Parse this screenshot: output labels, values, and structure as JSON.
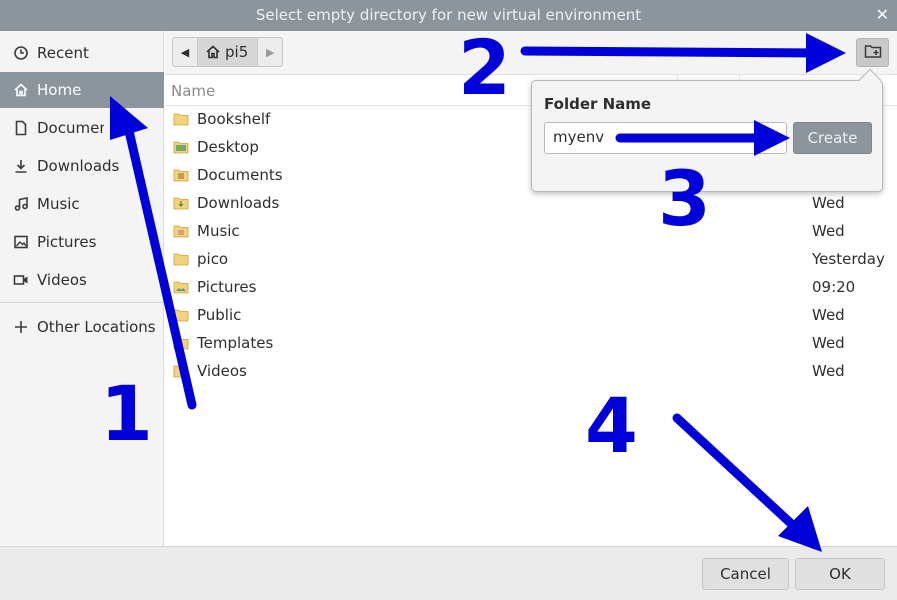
{
  "window": {
    "title": "Select empty directory for new virtual environment",
    "close_glyph": "✕"
  },
  "sidebar": {
    "items": [
      {
        "label": "Recent",
        "icon": "clock-icon"
      },
      {
        "label": "Home",
        "icon": "home-icon"
      },
      {
        "label": "Documents",
        "icon": "document-icon"
      },
      {
        "label": "Downloads",
        "icon": "download-icon"
      },
      {
        "label": "Music",
        "icon": "music-icon"
      },
      {
        "label": "Pictures",
        "icon": "picture-icon"
      },
      {
        "label": "Videos",
        "icon": "video-icon"
      }
    ],
    "other_locations": "Other Locations",
    "active": "Home"
  },
  "pathbar": {
    "back_glyph": "◀",
    "forward_glyph": "▶",
    "crumb": "pi5"
  },
  "columns": {
    "name": "Name"
  },
  "files": [
    {
      "name": "Bookshelf",
      "date": ""
    },
    {
      "name": "Desktop",
      "date": ""
    },
    {
      "name": "Documents",
      "date": ""
    },
    {
      "name": "Downloads",
      "date": "Wed"
    },
    {
      "name": "Music",
      "date": "Wed"
    },
    {
      "name": "pico",
      "date": "Yesterday"
    },
    {
      "name": "Pictures",
      "date": "09:20"
    },
    {
      "name": "Public",
      "date": "Wed"
    },
    {
      "name": "Templates",
      "date": "Wed"
    },
    {
      "name": "Videos",
      "date": "Wed"
    }
  ],
  "new_folder_popover": {
    "label": "Folder Name",
    "value": "myenv",
    "create_label": "Create"
  },
  "footer": {
    "cancel_label": "Cancel",
    "ok_label": "OK"
  },
  "annotations": {
    "step1": "1",
    "step2": "2",
    "step3": "3",
    "step4": "4",
    "color": "#0000d8"
  },
  "colors": {
    "accent": "#8c959c",
    "folder": "#f3d27a"
  }
}
